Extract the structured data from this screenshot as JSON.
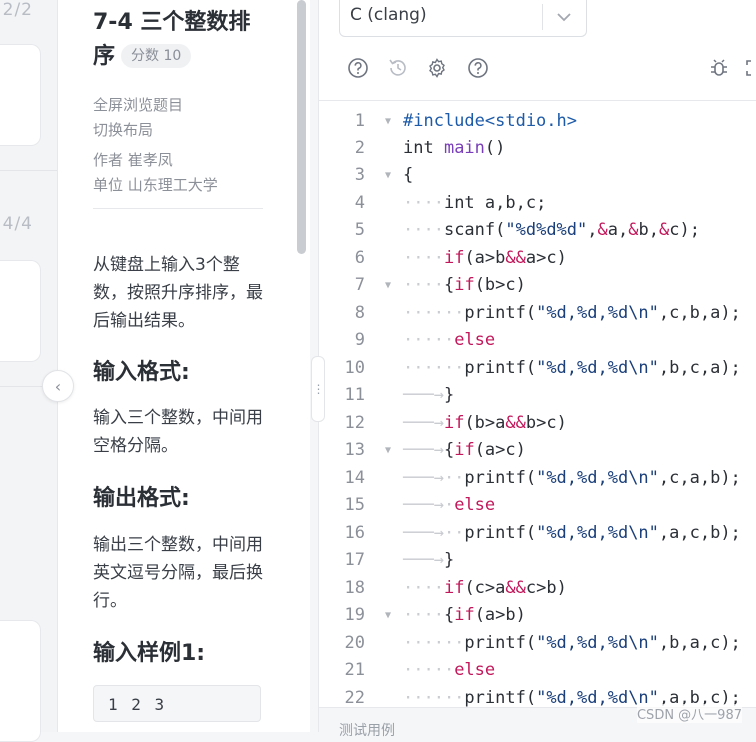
{
  "left_strip": {
    "counter_top": "2/2",
    "counter_bottom": "4/4"
  },
  "problem": {
    "title": "7-4 三个整数排序",
    "score": "分数 10",
    "links": [
      "全屏浏览题目",
      "切换布局"
    ],
    "author_label": "作者",
    "author": "崔孝凤",
    "unit_label": "单位",
    "unit": "山东理工大学",
    "description": "从键盘上输入3个整数，按照升序排序，最后输出结果。",
    "input_heading": "输入格式:",
    "input_text": "输入三个整数，中间用空格分隔。",
    "output_heading": "输出格式:",
    "output_text": "输出三个整数，中间用英文逗号分隔，最后换行。",
    "sample_heading": "输入样例1:",
    "sample_input": "1 2 3"
  },
  "editor": {
    "language": "C (clang)",
    "toolbar_icons": [
      "help-icon",
      "history-icon",
      "settings-icon",
      "question-icon",
      "debug-icon",
      "fullscreen-icon"
    ],
    "lines": [
      {
        "n": "1",
        "fold": true
      },
      {
        "n": "2",
        "fold": false
      },
      {
        "n": "3",
        "fold": true
      },
      {
        "n": "4",
        "fold": false
      },
      {
        "n": "5",
        "fold": false
      },
      {
        "n": "6",
        "fold": false
      },
      {
        "n": "7",
        "fold": true
      },
      {
        "n": "8",
        "fold": false
      },
      {
        "n": "9",
        "fold": false
      },
      {
        "n": "10",
        "fold": false
      },
      {
        "n": "11",
        "fold": false
      },
      {
        "n": "12",
        "fold": false
      },
      {
        "n": "13",
        "fold": true
      },
      {
        "n": "14",
        "fold": false
      },
      {
        "n": "15",
        "fold": false
      },
      {
        "n": "16",
        "fold": false
      },
      {
        "n": "17",
        "fold": false
      },
      {
        "n": "18",
        "fold": false
      },
      {
        "n": "19",
        "fold": true
      },
      {
        "n": "20",
        "fold": false
      },
      {
        "n": "21",
        "fold": false
      },
      {
        "n": "22",
        "fold": false
      }
    ],
    "bottom_label": "测试用例"
  },
  "watermark": "CSDN @八一987"
}
